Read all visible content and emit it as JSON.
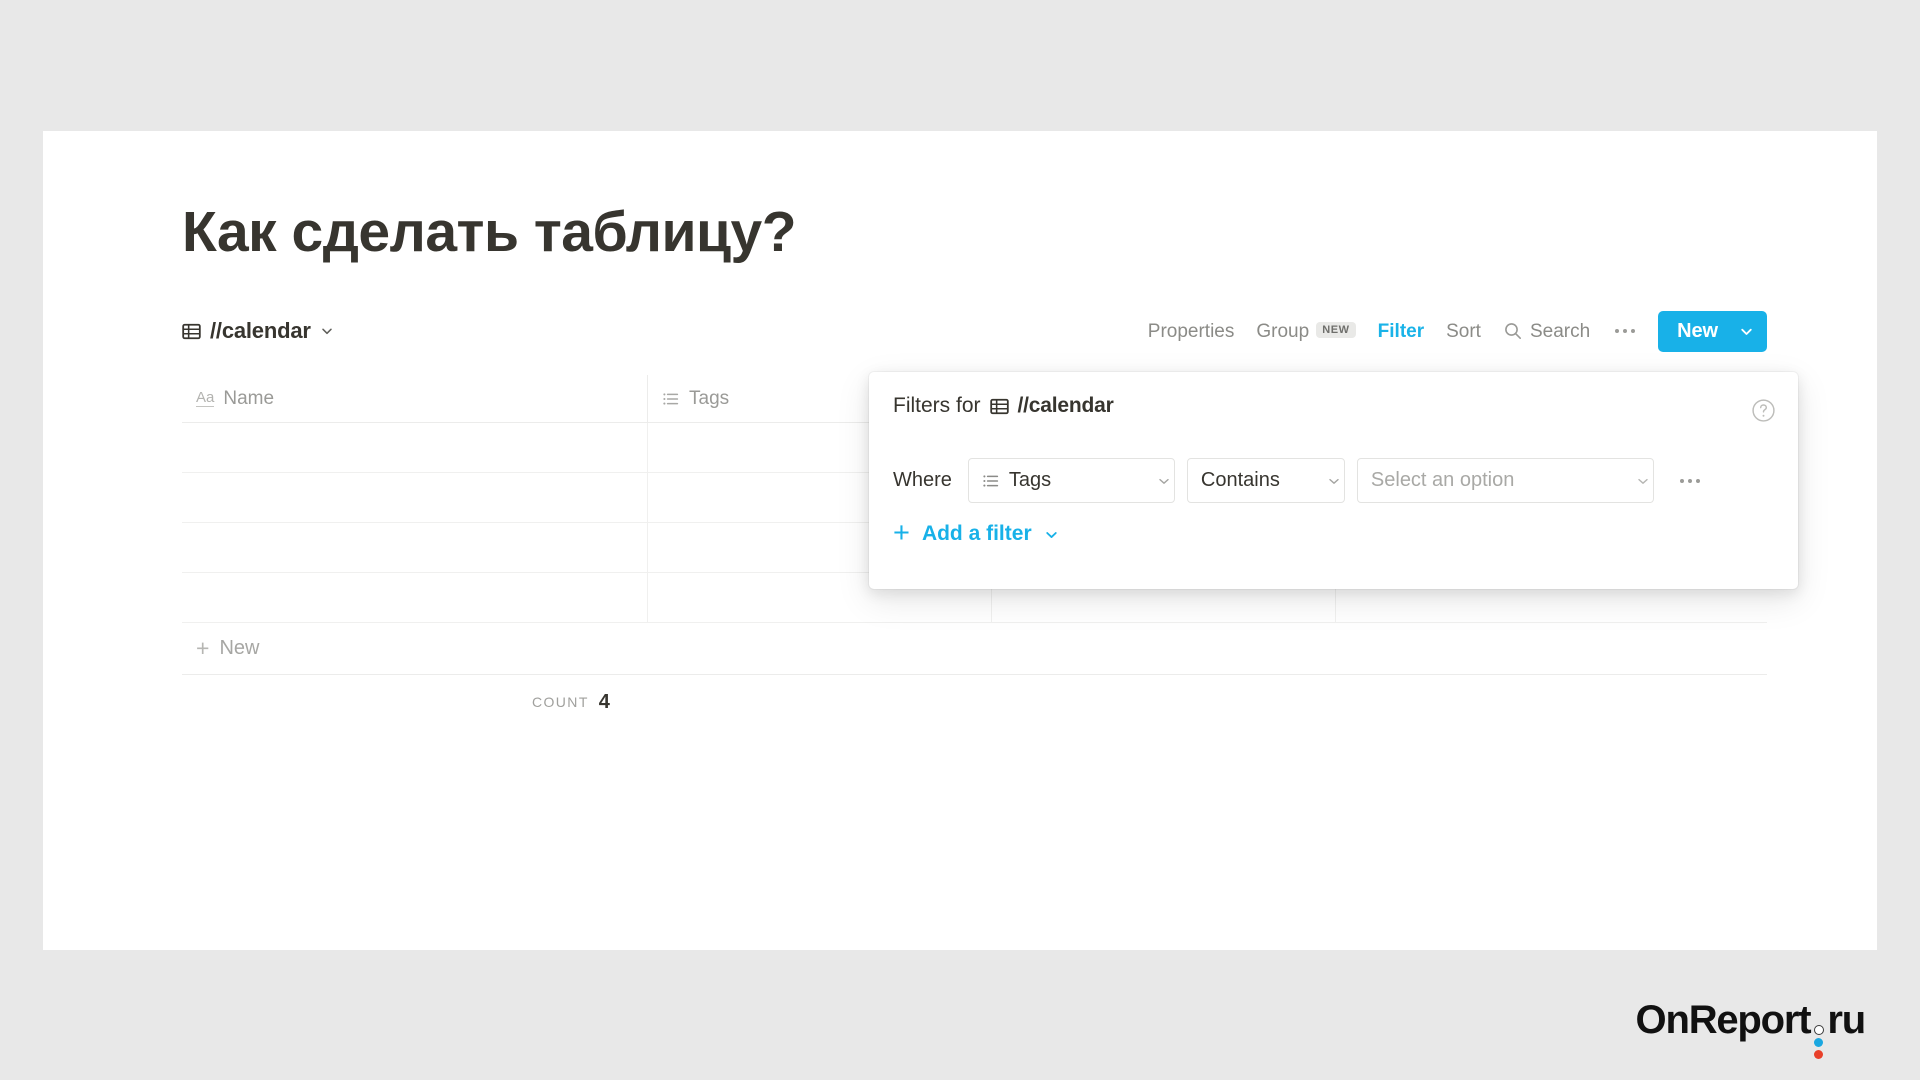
{
  "page": {
    "title": "Как сделать таблицу?",
    "background_color": "#e8e8e8",
    "card_color": "#ffffff"
  },
  "database": {
    "name": "//calendar",
    "icon": "table-icon",
    "chevron": "chevron-down-icon"
  },
  "toolbar": {
    "properties_label": "Properties",
    "group_label": "Group",
    "group_badge": "NEW",
    "filter_label": "Filter",
    "filter_active": true,
    "sort_label": "Sort",
    "search_label": "Search",
    "search_icon": "search-icon",
    "more_icon": "ellipsis-icon",
    "new_button_label": "New",
    "new_button_chevron": "chevron-down-icon",
    "accent_color": "#18b1e8"
  },
  "table": {
    "columns": [
      {
        "label": "Name",
        "icon": "text-aa-icon"
      },
      {
        "label": "Tags",
        "icon": "multiselect-list-icon"
      },
      {
        "label": "",
        "icon": ""
      },
      {
        "label": "",
        "icon": ""
      }
    ],
    "rows": [
      {
        "name": "",
        "tags": "",
        "c": "",
        "d": ""
      },
      {
        "name": "",
        "tags": "",
        "c": "",
        "d": ""
      },
      {
        "name": "",
        "tags": "",
        "c": "",
        "d": ""
      },
      {
        "name": "",
        "tags": "",
        "c": "",
        "d": ""
      }
    ],
    "new_row_label": "New",
    "new_row_icon": "plus-icon",
    "count_label": "COUNT",
    "count_value": "4"
  },
  "filter_popup": {
    "heading_prefix": "Filters for",
    "heading_db": "//calendar",
    "db_icon": "table-icon",
    "help_icon": "question-circle-icon",
    "where_label": "Where",
    "property_value": "Tags",
    "property_icon": "multiselect-list-icon",
    "operator_value": "Contains",
    "value_placeholder": "Select an option",
    "row_more_icon": "ellipsis-icon",
    "add_filter_label": "Add a filter",
    "add_filter_icon": "plus-icon",
    "add_filter_chevron": "chevron-down-icon"
  },
  "watermark": {
    "text_1": "OnReport",
    "text_2": "ru",
    "dot_open_color": "#ffffff",
    "dot_blue_color": "#1aa7e0",
    "dot_red_color": "#e8402a"
  }
}
